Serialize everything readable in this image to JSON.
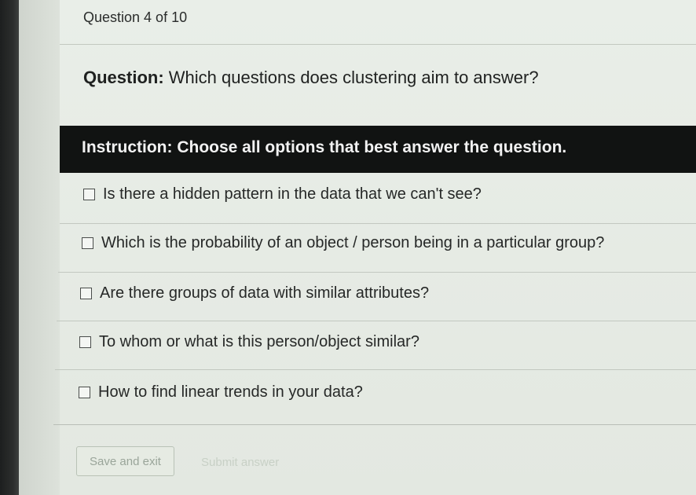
{
  "header": {
    "progress_text": "Question 4 of 10"
  },
  "question": {
    "prefix": "Question:",
    "text": "Which questions does clustering aim to answer?"
  },
  "instruction": {
    "prefix": "Instruction:",
    "text": "Choose all options that best answer the question."
  },
  "options": [
    {
      "label": "Is there a hidden pattern in the data that we can't see?",
      "checked": false
    },
    {
      "label": "Which is the probability of an object / person being in a particular group?",
      "checked": false
    },
    {
      "label": "Are there groups of data with similar attributes?",
      "checked": false
    },
    {
      "label": "To whom or what is this person/object similar?",
      "checked": false
    },
    {
      "label": "How to find linear trends in your data?",
      "checked": false
    }
  ],
  "footer": {
    "save_label": "Save and exit",
    "submit_label": "Submit answer"
  },
  "colors": {
    "instruction_bar": "#111312",
    "page_background": "#e8ece6"
  }
}
